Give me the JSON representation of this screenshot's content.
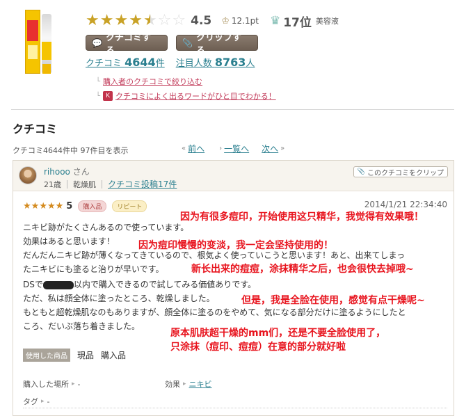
{
  "product": {
    "image_icon": "serum-tube-product-image",
    "rating_stars": 4.5,
    "rating_score": "4.5",
    "points": "12.1pt",
    "rank": "17位",
    "rank_category": "美容液",
    "buttons": {
      "kuchikomi": "クチコミする",
      "clip": "クリップする"
    },
    "kuchikomi_label": "クチコミ",
    "kuchikomi_count": "4644",
    "kuchikomi_unit": "件",
    "attention_label": "注目人数",
    "attention_count": "8763",
    "attention_unit": "人",
    "filter_link": "購入者のクチコミで絞り込む",
    "keyword_link": "クチコミによく出るワードがひと目でわかる！"
  },
  "section": {
    "title": "クチコミ",
    "pager_info": "クチコミ4644件中 97件目を表示",
    "prev": "前へ",
    "list": "一覧へ",
    "next": "次へ"
  },
  "review": {
    "user_name": "rihooo",
    "user_suffix": "さん",
    "age": "21歳",
    "skin": "乾燥肌",
    "posts_link": "クチコミ投稿17件",
    "clip_button": "このクチコミをクリップ",
    "stars": 5,
    "score": "5",
    "badge_purchase": "購入品",
    "badge_repeat": "リピート",
    "date": "2014/1/21 22:34:40",
    "lines": [
      "ニキビ跡がたくさんあるので使っています。",
      "効果はあると思います！",
      "だんだんニキビ跡が薄くなってきているので、根気よく使っていこうと思います！あと、出来てしまっ",
      "たニキビにも塗ると治りが早いです。",
      "以内で購入できるので試してみる価値ありです。",
      "ただ、私は顔全体に塗ったところ、乾燥しました。",
      "もともと超乾燥肌なのもありますが、顔全体に塗るのをやめて、気になる部分だけに塗るようにしたと",
      "ころ、だいぶ落ち着きました。"
    ],
    "line5_prefix": "DSで",
    "annotations": [
      "因为有很多痘印，开始使用这只精华，我觉得有效果哦！",
      "因为痘印慢慢的变淡，我一定会坚持使用的！",
      "新长出来的痘痘，涂抹精华之后，也会很快去掉哦~",
      "但是，我是全脸在使用，感觉有点干燥呢~",
      "原本肌肤超干燥的mm们，还是不要全脸使用了，",
      "只涂抹（痘印、痘痘）在意的部分就好啦"
    ],
    "used_label": "使用した商品",
    "used_values": [
      "現品",
      "購入品"
    ],
    "purchase_place_label": "購入した場所",
    "purchase_place_value": "-",
    "effect_label": "効果",
    "effect_value": "ニキビ",
    "tag_label": "タグ",
    "tag_value": "-"
  },
  "colors": {
    "link": "#2a7f8f",
    "annotation_red": "#e8141e",
    "star_gold": "#c9a227",
    "button_brown": "#7b6c60"
  }
}
